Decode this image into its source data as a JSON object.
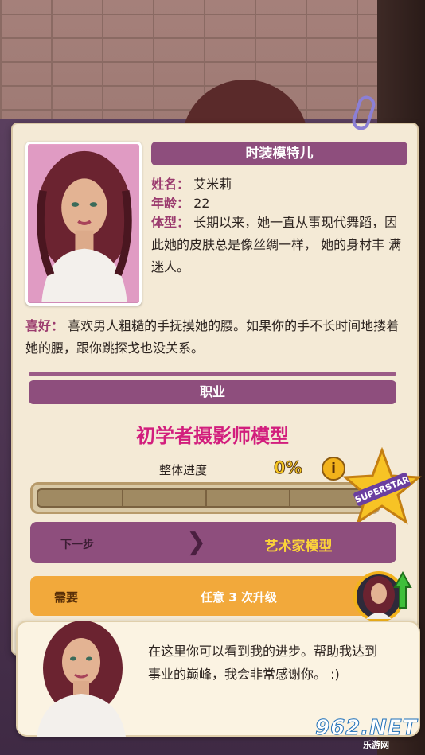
{
  "profile": {
    "title": "时装模特儿",
    "name_label": "姓名：",
    "name_value": "艾米莉",
    "age_label": "年龄：",
    "age_value": "22",
    "body_label": "体型：",
    "body_value": "长期以来，她一直从事现代舞蹈，因此她的皮肤总是像丝绸一样， 她的身材丰 满迷人。",
    "hobby_label": "喜好：",
    "hobby_value": "喜欢男人粗糙的手抚摸她的腰。如果你的手不长时间地搂着她的腰，跟你跳探戈也没关系。"
  },
  "career": {
    "section_title": "职业",
    "current_level": "初学者摄影师模型",
    "progress_label": "整体进度",
    "progress_percent": "0%",
    "progress_value": 0,
    "info_icon": "i",
    "star_text": "SUPERSTAR",
    "next_label": "下一步",
    "next_arrow": "❯",
    "next_target": "艺术家模型",
    "requirement_label": "需要",
    "requirement_value": "任意 3 次升级"
  },
  "speech": {
    "text": "在这里你可以看到我的进步。帮助我达到事业的巅峰，我会非常感谢你。 :)"
  },
  "watermark": {
    "main": "962.NET",
    "sub": "乐游网"
  },
  "colors": {
    "accent_purple": "#8e4e7d",
    "title_pink": "#d21e7d",
    "gold": "#f2b21b",
    "paper": "#f4ead6"
  }
}
